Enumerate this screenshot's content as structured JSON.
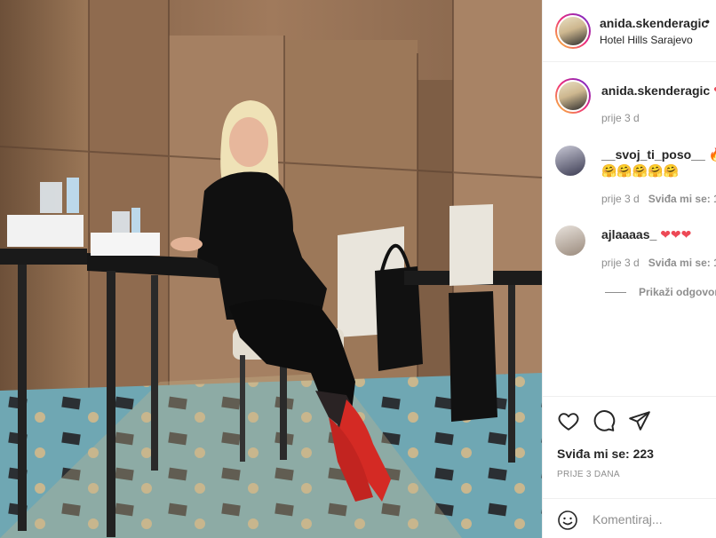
{
  "post": {
    "author": "anida.skenderagic",
    "dot": "•",
    "location": "Hotel Hills Sarajevo",
    "caption_author": "anida.skenderagic",
    "caption_emoji": "❤",
    "caption_time": "prije 3 d"
  },
  "comments": [
    {
      "user": "__svoj_ti_poso__",
      "text_line1": "🔥🔥",
      "text_line2": "🤗🤗🤗🤗🤗",
      "time": "prije 3 d",
      "like_label": "Sviđa mi se: 1"
    },
    {
      "user": "ajlaaaas_",
      "text_line1": "❤❤❤",
      "text_line2": "",
      "time": "prije 3 d",
      "like_label": "Sviđa mi se: 1"
    }
  ],
  "replies_toggle": "Prikaži odgovor",
  "actions": {
    "like_icon": "heart-icon",
    "comment_icon": "comment-bubble-icon",
    "share_icon": "paper-plane-icon",
    "likes_text": "Sviđa mi se: 223",
    "date_text": "PRIJE 3 DANA"
  },
  "add_comment": {
    "emoji_icon": "smile-icon",
    "placeholder": "Komentiraj..."
  },
  "colors": {
    "heart_red": "#ed4956",
    "text": "#262626",
    "muted": "#8e8e8e",
    "border": "#efefef"
  }
}
